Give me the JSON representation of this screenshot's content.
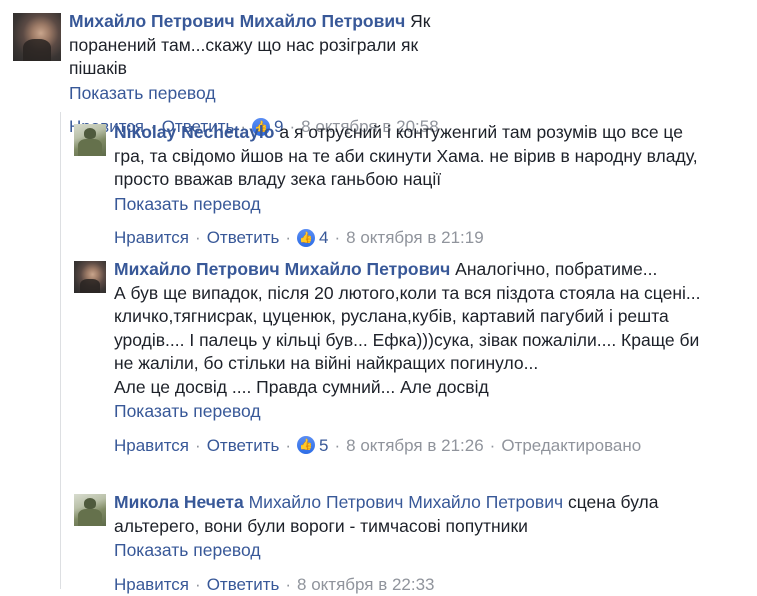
{
  "comments": [
    {
      "author": "Михайло Петрович Михайло Петрович",
      "mention": "",
      "text": "Як поранений там...скажу що нас розіграли як пішаків",
      "translate": "Показать перевод",
      "like": "Нравится",
      "reply": "Ответить",
      "reactions": "9",
      "time": "8 октября в 20:58",
      "edited": ""
    },
    {
      "author": "Nikolay Nechetaylo",
      "mention": "",
      "text": "а я отруєний і контуженгий там розумів що все це гра, та свідомо йшов на те аби скинути Хама. не вірив в народну владу, просто вважав владу зека ганьбою нації",
      "translate": "Показать перевод",
      "like": "Нравится",
      "reply": "Ответить",
      "reactions": "4",
      "time": "8 октября в 21:19",
      "edited": ""
    },
    {
      "author": "Михайло Петрович Михайло Петрович",
      "mention": "",
      "text_lines": [
        "Аналогічно, побратиме...",
        "А був ще випадок, після 20 лютого,коли та вся піздота стояла на сцені... кличко,тягнисрак, цуценюк, руслана,кубів, картавий пагубий і решта уродів.... І палець у кільці був... Ефка)))сука, зівак пожаліли.... Краще би не жаліли, бо стільки на війні найкращих погинуло...",
        "Але це досвід .... Правда сумний... Але досвід"
      ],
      "translate": "Показать перевод",
      "like": "Нравится",
      "reply": "Ответить",
      "reactions": "5",
      "time": "8 октября в 21:26",
      "edited": "Отредактировано"
    },
    {
      "author": "Микола Нечета",
      "mention": "Михайло Петрович Михайло Петрович",
      "text": "сцена була альтерего, вони були вороги - тимчасові попутники",
      "translate": "Показать перевод",
      "like": "Нравится",
      "reply": "Ответить",
      "reactions": "",
      "time": "8 октября в 22:33",
      "edited": ""
    }
  ],
  "icons": {
    "like": "like-icon"
  },
  "colors": {
    "link": "#385898",
    "meta": "#90949c",
    "text": "#1d2129",
    "like_icon": "#2d6de6"
  }
}
